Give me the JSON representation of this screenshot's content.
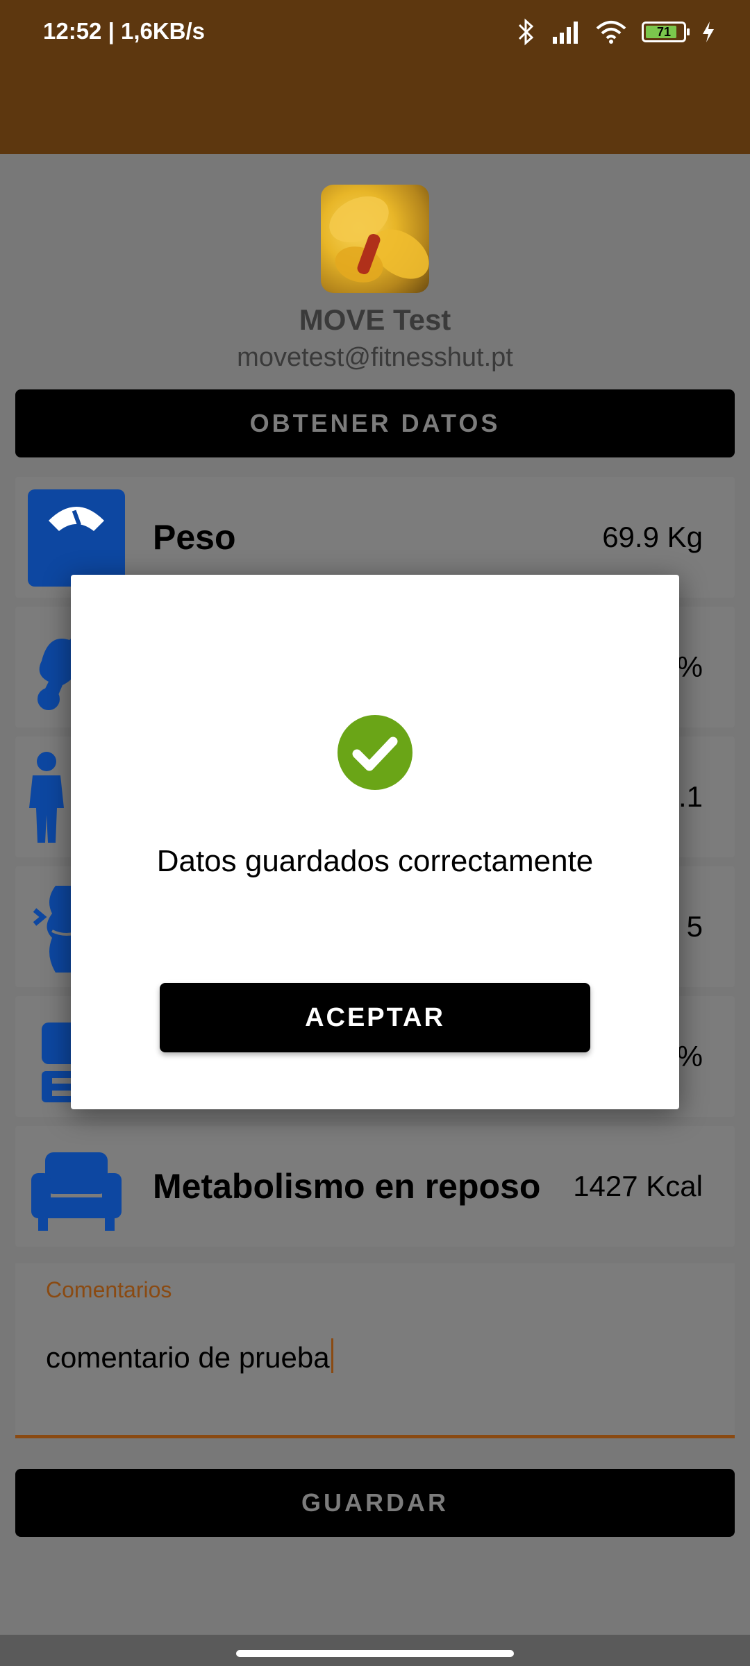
{
  "status_bar": {
    "time": "12:52 | 1,6KB/s",
    "battery": "71"
  },
  "profile": {
    "name": "MOVE Test",
    "email": "movetest@fitnesshut.pt"
  },
  "actions": {
    "fetch_label": "OBTENER DATOS",
    "save_label": "GUARDAR"
  },
  "metrics": [
    {
      "label": "Peso",
      "value": "69.9 Kg",
      "icon": "scale-icon"
    },
    {
      "label": "",
      "value": "%",
      "icon": "body-fat-icon"
    },
    {
      "label": "",
      "value": ".1",
      "icon": "body-figure-icon"
    },
    {
      "label": "",
      "value": "5",
      "icon": "visceral-fat-icon"
    },
    {
      "label": "",
      "value": "%",
      "icon": "muscle-icon"
    },
    {
      "label": "Metabolismo en reposo",
      "value": "1427 Kcal",
      "icon": "armchair-icon"
    }
  ],
  "comments": {
    "label": "Comentarios",
    "value": "comentario de prueba"
  },
  "dialog": {
    "message": "Datos guardados correctamente",
    "button_label": "ACEPTAR",
    "icon": "check-circle-icon"
  },
  "colors": {
    "header": "#5d370f",
    "accent": "#8a4a12",
    "icon_blue": "#0d47a1",
    "success_green": "#6aa517"
  }
}
